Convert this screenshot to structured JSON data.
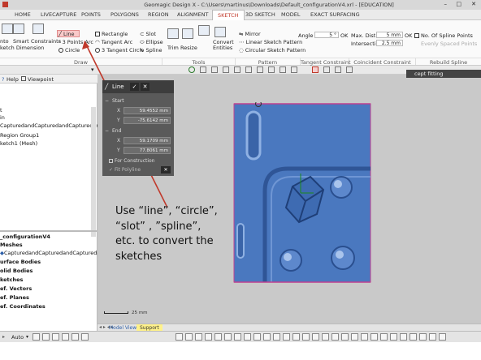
{
  "window": {
    "title": "Geomagic Design X - C:\\Users\\martinus\\Downloads\\Default_configurationV4.xrl - [EDUCATION]"
  },
  "tabs": [
    {
      "label": "HOME"
    },
    {
      "label": "LIVECAPTURE"
    },
    {
      "label": "POINTS"
    },
    {
      "label": "POLYGONS"
    },
    {
      "label": "REGION"
    },
    {
      "label": "ALIGNMENT"
    },
    {
      "label": "SKETCH"
    },
    {
      "label": "3D SKETCH"
    },
    {
      "label": "MODEL"
    },
    {
      "label": "EXACT SURFACING"
    }
  ],
  "ribbon": {
    "draw": {
      "left_labels": [
        "nto",
        "Smart",
        "Constraints",
        "ketch Dimension"
      ],
      "line": "Line",
      "three_points_arc": "3 Points Arc",
      "circle": "Circle",
      "rectangle": "Rectangle",
      "tangent_arc": "Tangent Arc",
      "three_tangent_circle": "3 Tangent Circle",
      "slot": "Slot",
      "ellipse": "Ellipse",
      "spline": "Spline",
      "group": "Draw"
    },
    "tools": {
      "trim": "Trim",
      "resize": "Resize",
      "convert": "Convert Entities",
      "group": "Tools"
    },
    "pattern": {
      "mirror": "Mirror",
      "linear": "Linear Sketch Pattern",
      "circular": "Circular Sketch Pattern",
      "group": "Pattern"
    },
    "tangent": {
      "angle_label": "Angle",
      "angle_value": "5 °",
      "ok1": "OK",
      "max_dist_label": "Max. Dist.",
      "max_dist_value": "5 mm",
      "ok2": "OK",
      "intersection_label": "Intersection",
      "intersection_value": "2.5 mm",
      "group": "Tangent Constraint"
    },
    "coincident": {
      "group": "Coincident Constraint"
    },
    "spline": {
      "num_points": "No. Of Spline Points",
      "evenly": "Evenly Spaced Points",
      "group": "Rebuild Spline"
    }
  },
  "left_panel": {
    "header": {
      "help": "Help",
      "viewpoint": "Viewpoint"
    },
    "upper_items": [
      "t",
      "in",
      "CapturedandCapturedandCapturedandCa",
      "Region Group1",
      "ketch1 (Mesh)"
    ],
    "lower_items": [
      {
        "label": "_configurationV4",
        "bold": true
      },
      {
        "label": "Meshes",
        "bold": true
      },
      {
        "label": "CapturedandCapturedandCapturedandCa",
        "bold": false
      },
      {
        "label": "urface Bodies",
        "bold": true
      },
      {
        "label": "olid Bodies",
        "bold": true
      },
      {
        "label": "ketches",
        "bold": true
      },
      {
        "label": "ef. Vectors",
        "bold": true
      },
      {
        "label": "ef. Planes",
        "bold": true
      },
      {
        "label": "ef. Coordinates",
        "bold": true
      }
    ]
  },
  "dialog": {
    "title": "Line",
    "ok": "✓",
    "cancel": "✕",
    "start_label": "Start",
    "start_x": "59.4552 mm",
    "start_y": "-75.6142 mm",
    "end_label": "End",
    "end_x": "59.1709 mm",
    "end_y": "77.8061 mm",
    "x_label": "X",
    "y_label": "Y",
    "for_construction": "For Construction",
    "fit_polyline": "Fit Polyline"
  },
  "viewport": {
    "fit_label": "cept fitting",
    "annotation": "Use “line”, “circle”,\n“slot” , ”spline”,\netc. to convert the\nsketches",
    "scale": "25 mm"
  },
  "bottom_tabs": [
    {
      "label": "Model View"
    },
    {
      "label": "Support"
    }
  ],
  "status": {
    "auto": "Auto"
  },
  "colors": {
    "accent": "#c0392b",
    "mesh": "#4a78bf",
    "highlight": "#f9c9c9"
  }
}
